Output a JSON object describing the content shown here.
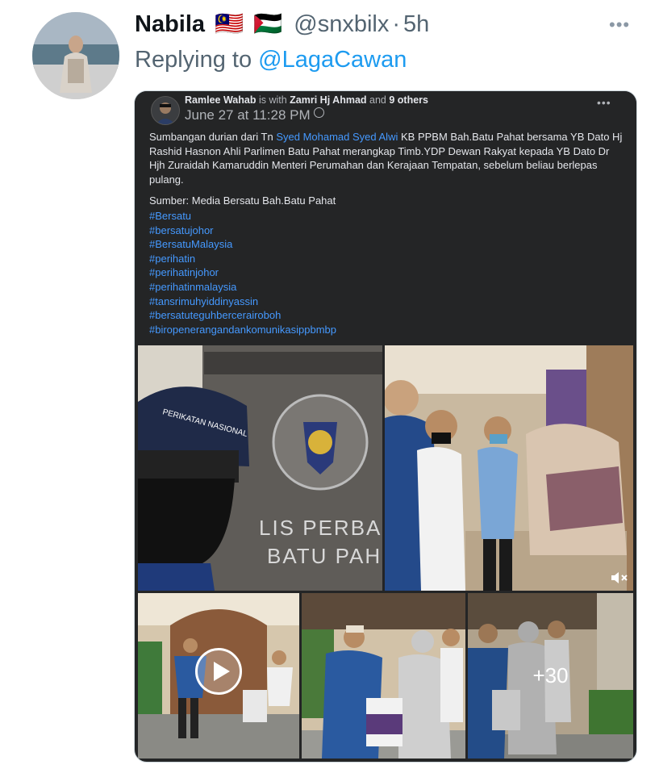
{
  "tweet": {
    "display_name": "Nabila",
    "flags": [
      "🇲🇾",
      "🇵🇸"
    ],
    "handle": "@snxbilx",
    "separator": "·",
    "time": "5h",
    "more_icon": "more-dots-icon",
    "reply_prefix": "Replying to",
    "reply_to": "@LagaCawan"
  },
  "fb_post": {
    "author": "Ramlee Wahab",
    "with_text": "is with",
    "with_person": "Zamri Hj Ahmad",
    "and_text": "and",
    "others": "9 others",
    "date": "June 27 at 11:28 PM",
    "privacy_icon": "globe-icon",
    "more_icon": "more-dots-icon",
    "text_before_mention": "Sumbangan durian dari Tn",
    "mention": "Syed Mohamad Syed Alwi",
    "text_after_mention": "KB PPBM Bah.Batu Pahat bersama YB Dato Hj Rashid Hasnon Ahli Parlimen Batu Pahat merangkap Timb.YDP Dewan Rakyat kepada YB Dato Dr Hjh Zuraidah Kamaruddin Menteri Perumahan dan Kerajaan Tempatan, sebelum beliau berlepas pulang.",
    "source": "Sumber: Media Bersatu Bah.Batu Pahat",
    "hashtags": [
      "#Bersatu",
      "#bersatujohor",
      "#BersatuMalaysia",
      "#perihatin",
      "#perihatinjohor",
      "#perihatinmalaysia",
      "#tansrimuhyiddinyassin",
      "#bersatuteguhbercerairoboh",
      "#biropenerangandankomunikasippbmbp"
    ],
    "photos": {
      "photo1_sign_text_1": "LIS PERBAN",
      "photo1_sign_text_2": "BATU PAH",
      "photo1_cap_text": "PERIKATAN NASIONAL",
      "more_count": "+30"
    }
  }
}
